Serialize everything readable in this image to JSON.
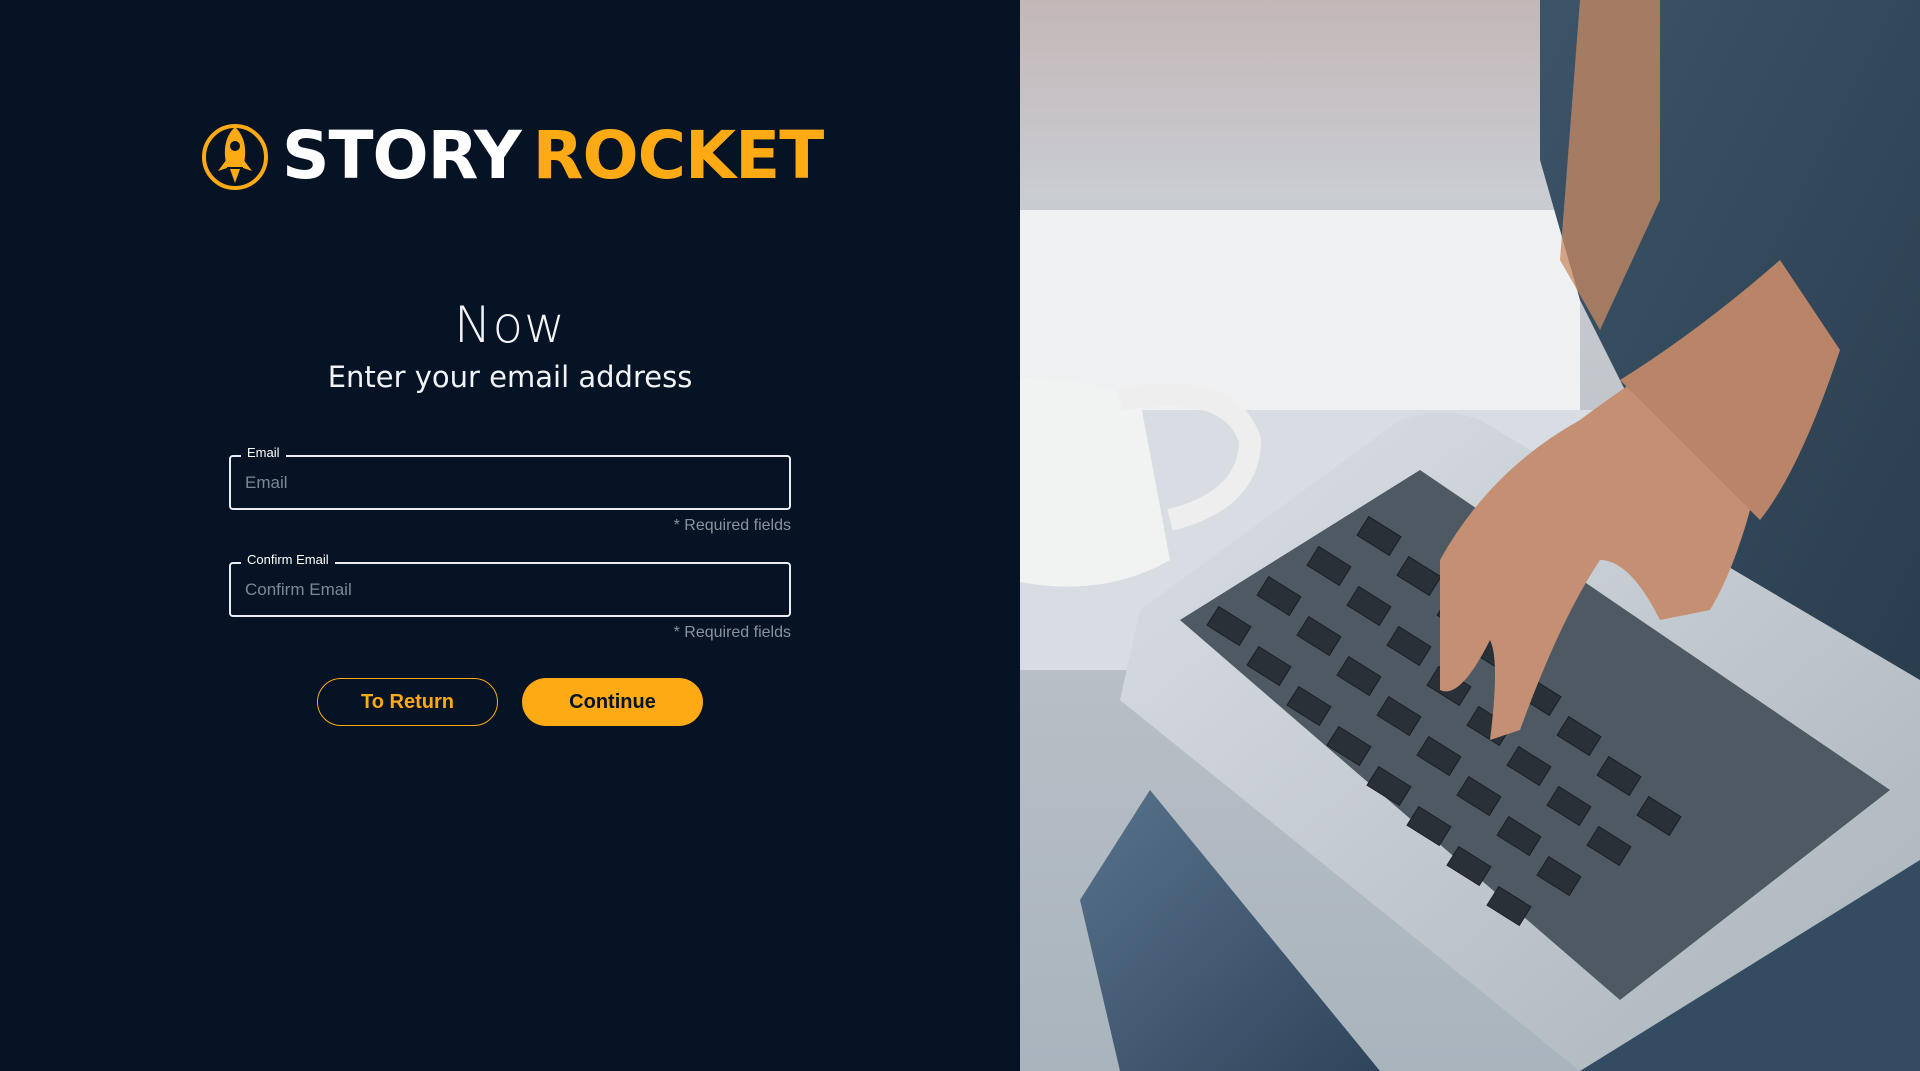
{
  "brand": {
    "word1": "STORY",
    "word2": "ROCKET"
  },
  "heading": "Now",
  "subheading": "Enter your email address",
  "form": {
    "email": {
      "label": "Email",
      "placeholder": "Email",
      "value": "",
      "hint": "* Required fields"
    },
    "confirm_email": {
      "label": "Confirm Email",
      "placeholder": "Confirm Email",
      "value": "",
      "hint": "* Required fields"
    }
  },
  "buttons": {
    "return_label": "To Return",
    "continue_label": "Continue"
  },
  "colors": {
    "background": "#061324",
    "accent": "#fdaa14",
    "text": "#ffffff"
  },
  "icons": {
    "logo": "rocket-icon"
  }
}
